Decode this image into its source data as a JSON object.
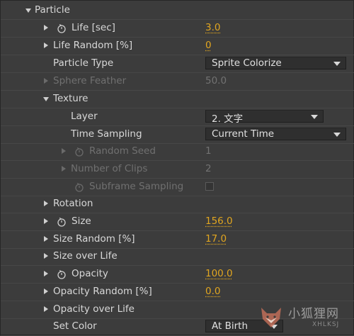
{
  "section": {
    "label": "Particle"
  },
  "rows": {
    "life": {
      "label": "Life [sec]",
      "value": "3.0"
    },
    "life_random": {
      "label": "Life Random [%]",
      "value": "0"
    },
    "particle_type": {
      "label": "Particle Type",
      "value": "Sprite Colorize"
    },
    "sphere_feather": {
      "label": "Sphere Feather",
      "value": "50.0"
    },
    "texture": {
      "label": "Texture"
    },
    "layer": {
      "label": "Layer",
      "value": "2. 文字"
    },
    "time_sampling": {
      "label": "Time Sampling",
      "value": "Current Time"
    },
    "random_seed": {
      "label": "Random Seed",
      "value": "1"
    },
    "number_of_clips": {
      "label": "Number of Clips",
      "value": "2"
    },
    "subframe_sampling": {
      "label": "Subframe Sampling"
    },
    "rotation": {
      "label": "Rotation"
    },
    "size": {
      "label": "Size",
      "value": "156.0"
    },
    "size_random": {
      "label": "Size Random [%]",
      "value": "17.0"
    },
    "size_over_life": {
      "label": "Size over Life"
    },
    "opacity": {
      "label": "Opacity",
      "value": "100.0"
    },
    "opacity_random": {
      "label": "Opacity Random [%]",
      "value": "0.0"
    },
    "opacity_over_life": {
      "label": "Opacity over Life"
    },
    "set_color": {
      "label": "Set Color",
      "value": "At Birth"
    }
  },
  "watermark": {
    "text": "小狐狸网",
    "sub": "XHLKSJ"
  },
  "colors": {
    "value_accent": "#e1a620",
    "panel_bg": "#3c3c3c",
    "dim_text": "#707070"
  },
  "icons": [
    "twisty-open-icon",
    "twisty-closed-icon",
    "stopwatch-icon",
    "dropdown-arrow-icon",
    "fox-logo-icon"
  ]
}
